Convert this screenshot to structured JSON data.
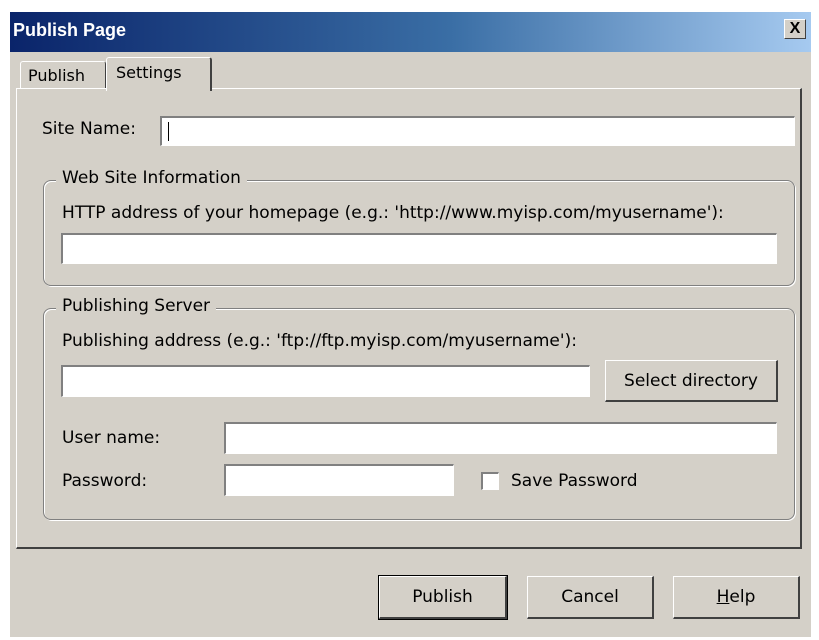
{
  "window": {
    "title": "Publish Page",
    "close_glyph": "X"
  },
  "tabs": [
    {
      "label": "Publish"
    },
    {
      "label": "Settings"
    }
  ],
  "settings": {
    "site_name_label": "Site Name:",
    "site_name_value": "",
    "web_site_group": {
      "legend": "Web Site Information",
      "http_label": "HTTP address of your homepage (e.g.: 'http://www.myisp.com/myusername'):",
      "http_value": ""
    },
    "publishing_group": {
      "legend": "Publishing Server",
      "address_label": "Publishing address (e.g.: 'ftp://ftp.myisp.com/myusername'):",
      "address_value": "",
      "select_directory_label": "Select directory",
      "username_label": "User name:",
      "username_value": "",
      "password_label": "Password:",
      "password_value": "",
      "save_password_label": "Save Password",
      "save_password_checked": false
    }
  },
  "footer": {
    "publish_label": "Publish",
    "cancel_label": "Cancel",
    "help_label_prefix": "H",
    "help_label_rest": "elp"
  }
}
